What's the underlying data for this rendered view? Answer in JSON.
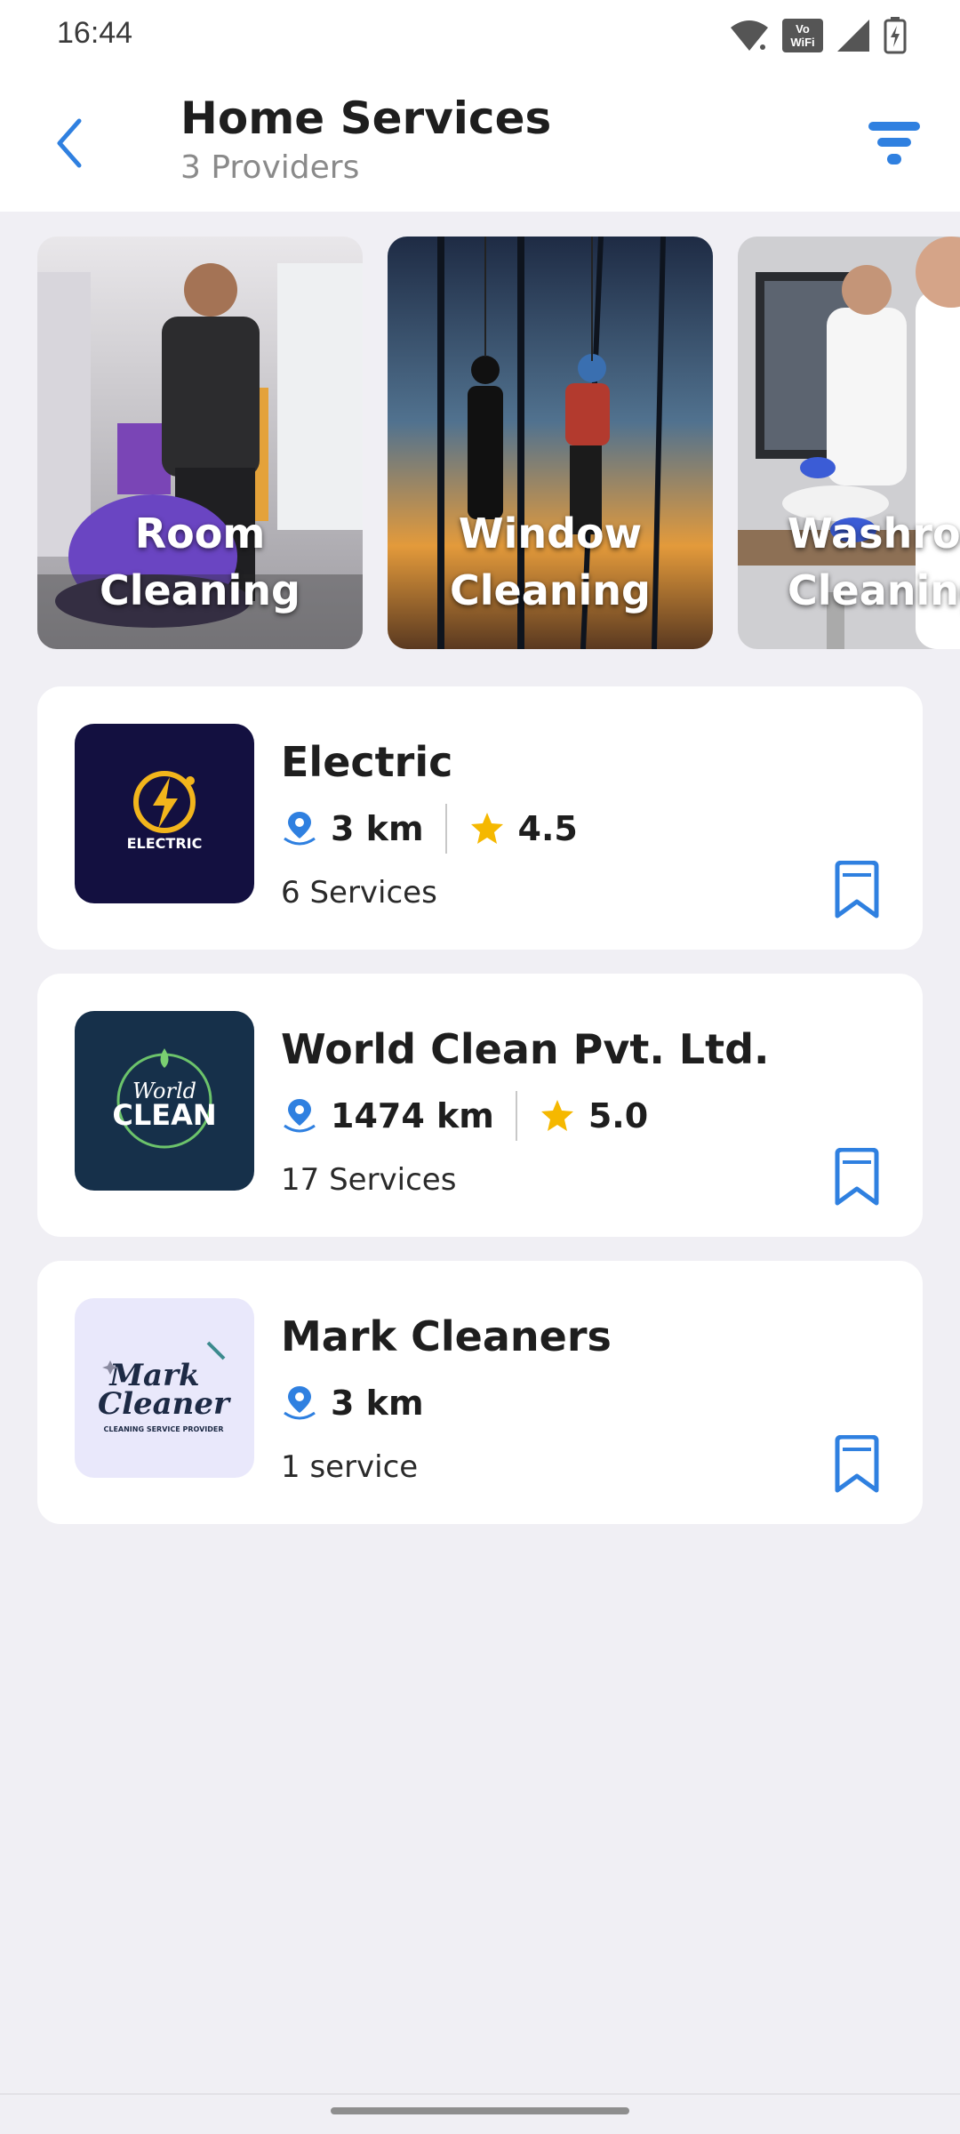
{
  "status_bar": {
    "time": "16:44",
    "vowifi_top": "Vo",
    "vowifi_bottom": "WiFi"
  },
  "header": {
    "title": "Home Services",
    "subtitle": "3 Providers"
  },
  "categories": [
    {
      "label": "Room Cleaning"
    },
    {
      "label": "Window\nCleaning"
    },
    {
      "label": "Washroom\nCleaning"
    }
  ],
  "providers": [
    {
      "name": "Electric",
      "distance": "3 km",
      "rating": "4.5",
      "services": "6 Services",
      "logo_text": "ELECTRIC"
    },
    {
      "name": "World Clean Pvt. Ltd.",
      "distance": "1474 km",
      "rating": "5.0",
      "services": "17 Services",
      "logo_text_1": "World",
      "logo_text_2": "CLEAN"
    },
    {
      "name": "Mark Cleaners",
      "distance": "3 km",
      "services": "1 service",
      "logo_text_1": "Mark",
      "logo_text_2": "Cleaner",
      "logo_text_3": "CLEANING SERVICE PROVIDER"
    }
  ],
  "colors": {
    "accent": "#2f80e0",
    "star": "#f5b800",
    "background": "#f0eff4"
  }
}
